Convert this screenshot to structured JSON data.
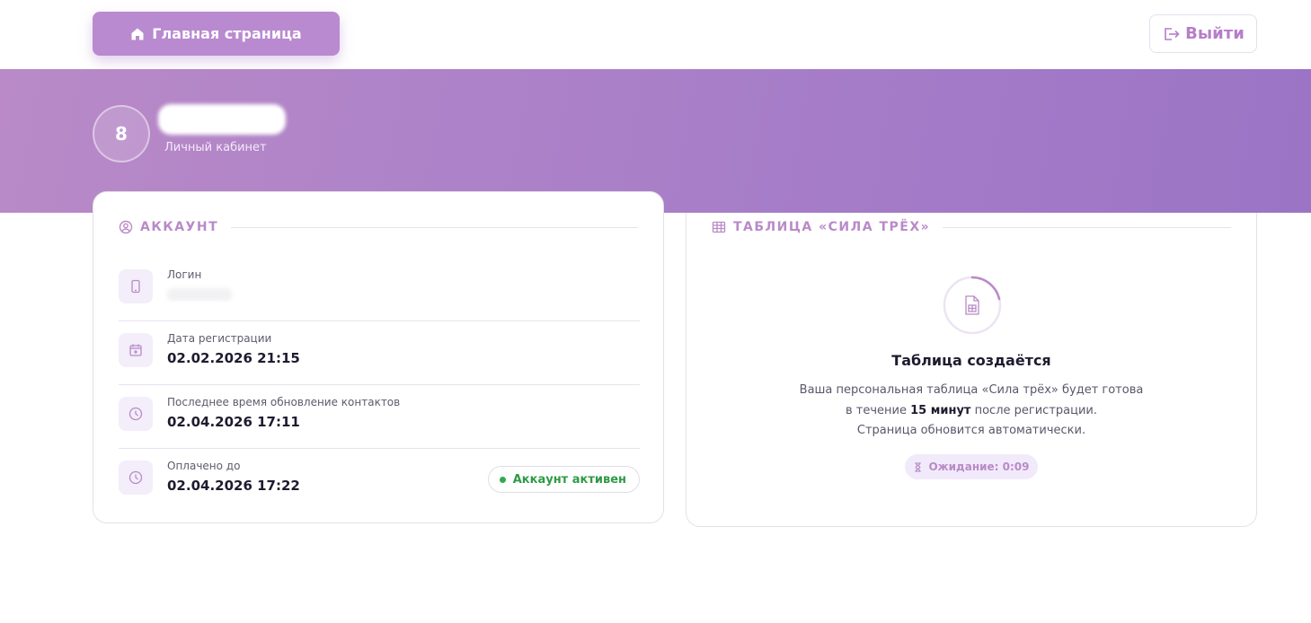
{
  "nav": {
    "home_label": "Главная страница",
    "logout_label": "Выйти"
  },
  "profile": {
    "avatar_letter": "8",
    "subtitle": "Личный кабинет"
  },
  "account": {
    "section_title": "АККАУНТ",
    "rows": [
      {
        "label": "Логин",
        "value": ""
      },
      {
        "label": "Дата регистрации",
        "value": "02.02.2026 21:15"
      },
      {
        "label": "Последнее время обновление контактов",
        "value": "02.04.2026 17:11"
      },
      {
        "label": "Оплачено до",
        "value": "02.04.2026 17:22"
      }
    ],
    "status_badge": "Аккаунт активен"
  },
  "table_card": {
    "section_title": "ТАБЛИЦА «СИЛА ТРЁХ»",
    "status_title": "Таблица создаётся",
    "text_line1": "Ваша персональная таблица «Сила трёх» будет готова",
    "text_line2_prefix": "в течение ",
    "text_line2_bold": "15 минут",
    "text_line2_suffix": " после регистрации.",
    "text_line3": "Страница обновится автоматически.",
    "wait_label": "Ожидание: 0:09"
  },
  "colors": {
    "accent": "#b98ac7",
    "banner_start": "#b98ac7",
    "banner_end": "#9b74c6",
    "success": "#2e9a45"
  },
  "icons": {
    "home": "home-icon",
    "logout": "logout-icon",
    "account": "user-circle-icon",
    "login": "phone-icon",
    "registration": "calendar-icon",
    "updated": "clock-icon",
    "paid": "clock-icon",
    "table": "table-icon",
    "spinner": "spreadsheet-file-icon",
    "wait": "hourglass-icon"
  }
}
